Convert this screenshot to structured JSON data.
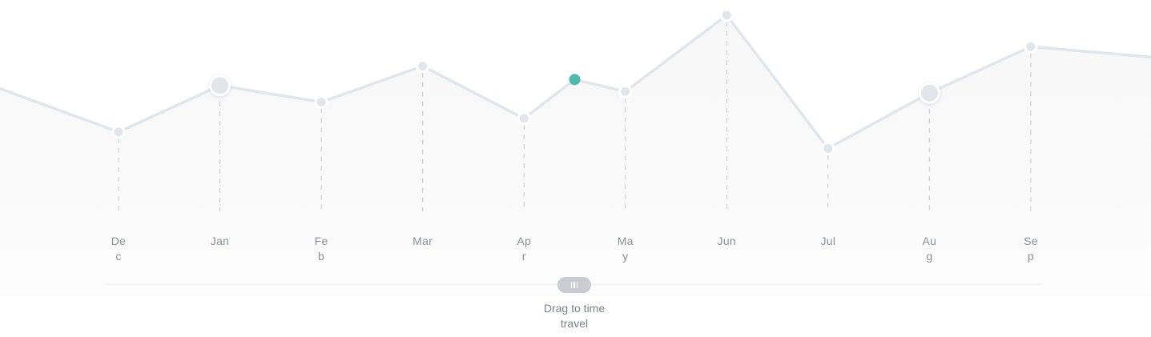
{
  "chart_data": {
    "type": "line",
    "categories": [
      "Dec",
      "Jan",
      "Feb",
      "Mar",
      "Apr",
      "May",
      "Jun",
      "Jul",
      "Aug",
      "Sep"
    ],
    "label_lines": [
      [
        "De",
        "c"
      ],
      [
        "Jan"
      ],
      [
        "Fe",
        "b"
      ],
      [
        "Mar"
      ],
      [
        "Ap",
        "r"
      ],
      [
        "Ma",
        "y"
      ],
      [
        "Jun"
      ],
      [
        "Jul"
      ],
      [
        "Au",
        "g"
      ],
      [
        "Se",
        "p"
      ]
    ],
    "series": [
      {
        "values": [
          22,
          53,
          42,
          66,
          31,
          49,
          100,
          11,
          48,
          79
        ]
      }
    ],
    "lead_in_value": 51,
    "trail_out_value": 72,
    "highlighted_point": {
      "between": [
        "Apr",
        "May"
      ],
      "position": 0.5,
      "value": 57
    },
    "large_markers": [
      "Jan",
      "Aug"
    ],
    "ylim": [
      0,
      100
    ],
    "grid": "dashed vertical drop lines",
    "legend": "none",
    "colors": {
      "line": "#e2e5e9",
      "area": "#f7f7f8",
      "marker_fill": "#e2e5e9",
      "marker_stroke": "#ffffff",
      "highlight": "#4fb9ad",
      "dropline": "#c6c9ce"
    }
  },
  "slider": {
    "hint": "Drag to time travel",
    "hint_lines": [
      "Drag to time",
      "travel"
    ],
    "handle_icon": "grip-lines-icon"
  }
}
